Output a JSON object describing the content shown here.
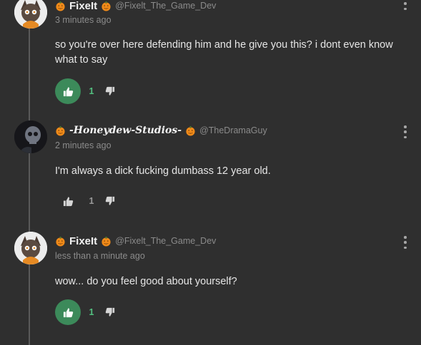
{
  "colors": {
    "background": "#2f2f2f",
    "upvote_active": "#3c8a5a",
    "count_active": "#53c180",
    "text": "#e6e6e6",
    "muted": "#8b8b8b"
  },
  "comments": [
    {
      "display_name": "FixeIt",
      "handle": "@Fixelt_The_Game_Dev",
      "timestamp": "3 minutes ago",
      "text": "so you're over here defending him and he give you this? i dont even know what to say",
      "votes": "1",
      "upvoted": true,
      "avatar_icon": "character-avatar-icon"
    },
    {
      "display_name": "-Honeydew-Studios-",
      "handle": "@TheDramaGuy",
      "timestamp": "2 minutes ago",
      "text": "I'm always a dick fucking dumbass 12 year old.",
      "votes": "1",
      "upvoted": false,
      "avatar_icon": "skull-avatar-icon"
    },
    {
      "display_name": "FixeIt",
      "handle": "@Fixelt_The_Game_Dev",
      "timestamp": "less than a minute ago",
      "text": "wow... do you feel good about yourself?",
      "votes": "1",
      "upvoted": true,
      "avatar_icon": "character-avatar-icon"
    }
  ]
}
